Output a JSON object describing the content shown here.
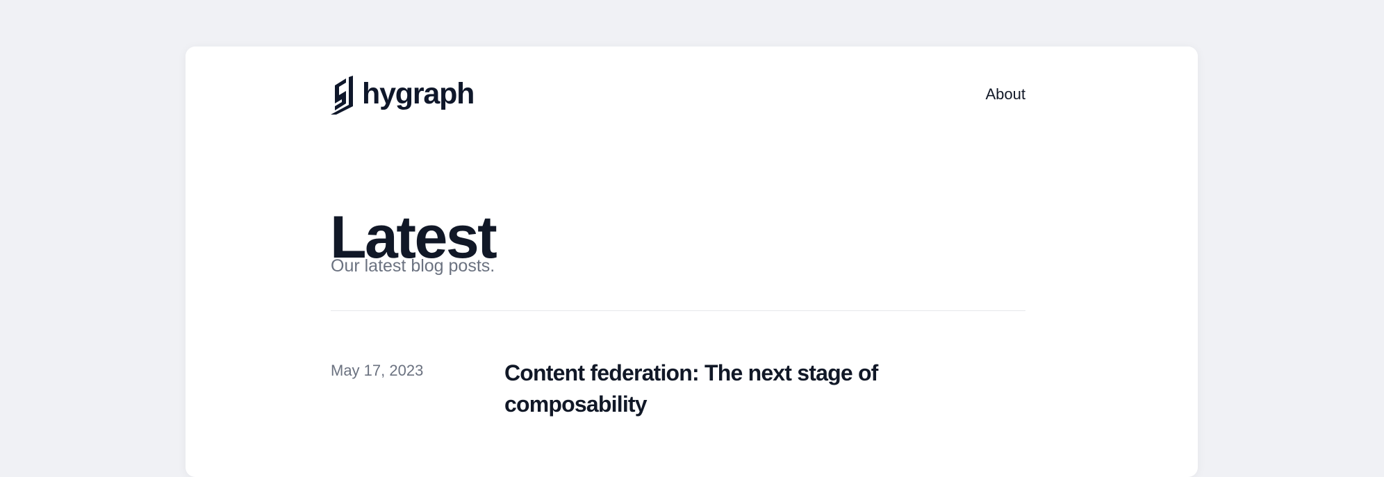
{
  "header": {
    "logo_text": "hygraph",
    "logo_icon": "hygraph-logo-icon",
    "nav": {
      "about_label": "About"
    }
  },
  "main": {
    "title": "Latest",
    "subtitle": "Our latest blog posts."
  },
  "posts": [
    {
      "date": "May 17, 2023",
      "title": "Content federation: The next stage of composability"
    }
  ],
  "colors": {
    "page_background": "#f0f1f5",
    "card_background": "#ffffff",
    "heading": "#111827",
    "muted_text": "#6b7280",
    "divider": "#e5e7eb"
  }
}
